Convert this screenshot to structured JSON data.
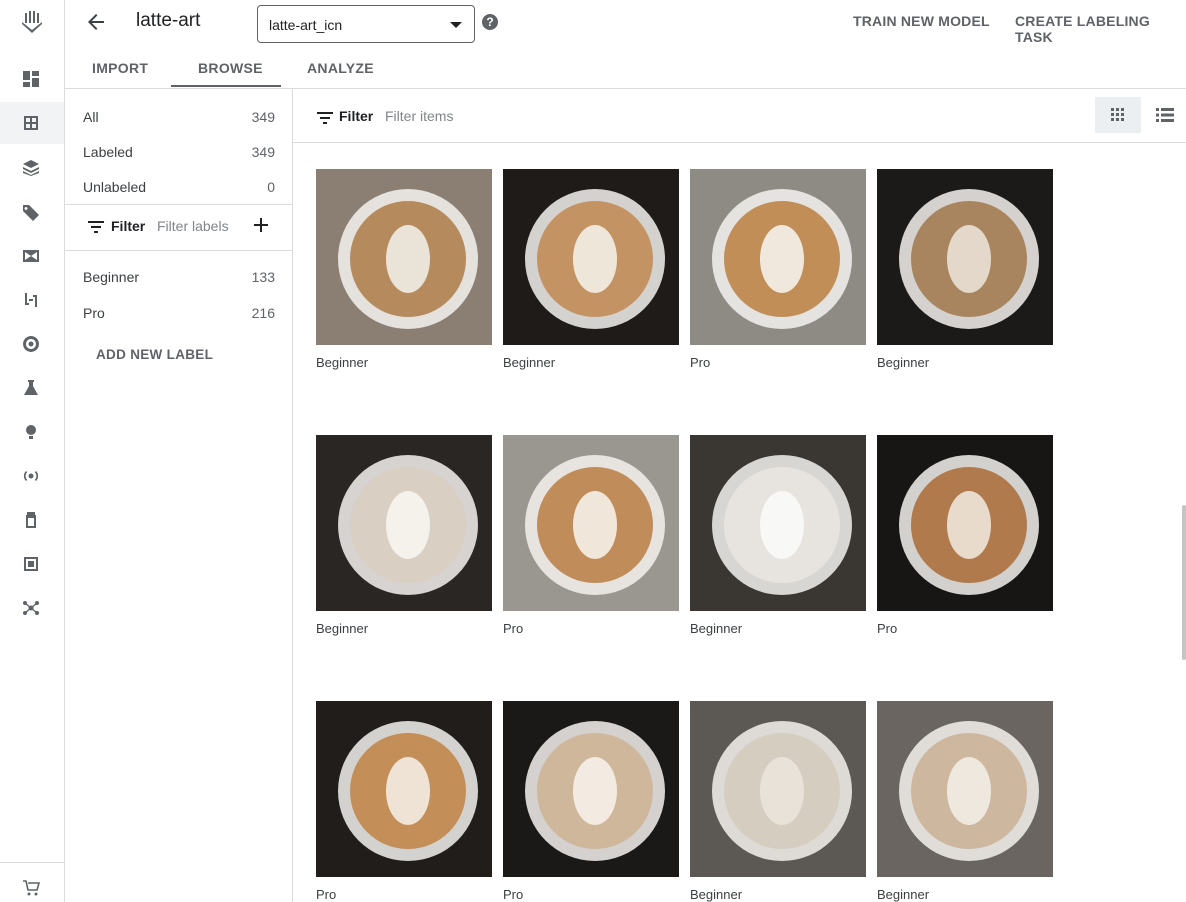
{
  "header": {
    "title": "latte-art",
    "dataset_select": "latte-art_icn",
    "help": "?",
    "train_button": "TRAIN NEW MODEL",
    "labeling_button": "CREATE LABELING TASK"
  },
  "tabs": [
    "IMPORT",
    "BROWSE",
    "ANALYZE"
  ],
  "active_tab": "BROWSE",
  "panel": {
    "counts": [
      {
        "label": "All",
        "count": "349"
      },
      {
        "label": "Labeled",
        "count": "349"
      },
      {
        "label": "Unlabeled",
        "count": "0"
      }
    ],
    "filter_label": "Filter",
    "filter_placeholder": "Filter labels",
    "labels": [
      {
        "label": "Beginner",
        "count": "133"
      },
      {
        "label": "Pro",
        "count": "216"
      }
    ],
    "add_label": "ADD NEW LABEL"
  },
  "toolbar": {
    "filter_label": "Filter",
    "filter_placeholder": "Filter items"
  },
  "items": [
    {
      "label": "Beginner",
      "bg": "#8a7f72",
      "cup": "#b58a5c",
      "art": "#f0ece6"
    },
    {
      "label": "Beginner",
      "bg": "#1f1b18",
      "cup": "#c49363",
      "art": "#f4efe7"
    },
    {
      "label": "Pro",
      "bg": "#8e8a84",
      "cup": "#c18e57",
      "art": "#f6f2ec"
    },
    {
      "label": "Beginner",
      "bg": "#1c1a18",
      "cup": "#a9855f",
      "art": "#e9e1d6"
    },
    {
      "label": "Beginner",
      "bg": "#2a2623",
      "cup": "#d9cfc3",
      "art": "#f7f4ef"
    },
    {
      "label": "Pro",
      "bg": "#9a9690",
      "cup": "#c08c5a",
      "art": "#f5f0e8"
    },
    {
      "label": "Beginner",
      "bg": "#3a3632",
      "cup": "#e7e3de",
      "art": "#fafafa"
    },
    {
      "label": "Pro",
      "bg": "#171615",
      "cup": "#b07a4c",
      "art": "#efe6da"
    },
    {
      "label": "Pro",
      "bg": "#201d1a",
      "cup": "#c48e58",
      "art": "#f3ece2"
    },
    {
      "label": "Pro",
      "bg": "#1b1917",
      "cup": "#cfb79b",
      "art": "#f6f1ea"
    },
    {
      "label": "Beginner",
      "bg": "#5c5853",
      "cup": "#d6cdc1",
      "art": "#ebe4da"
    },
    {
      "label": "Beginner",
      "bg": "#6a6560",
      "cup": "#cdb79e",
      "art": "#f2ede6"
    }
  ],
  "colors": {
    "border": "#dadce0",
    "text_secondary": "#5f6368",
    "active_tab": "#5f6368"
  },
  "rail_icons": [
    "dashboard-icon",
    "datasets-icon",
    "features-icon",
    "labeling-icon",
    "workbench-icon",
    "pipelines-icon",
    "training-icon",
    "experiments-icon",
    "models-icon",
    "endpoints-icon",
    "batch-predictions-icon",
    "metadata-icon",
    "matching-engine-icon",
    "marketplace-icon"
  ]
}
